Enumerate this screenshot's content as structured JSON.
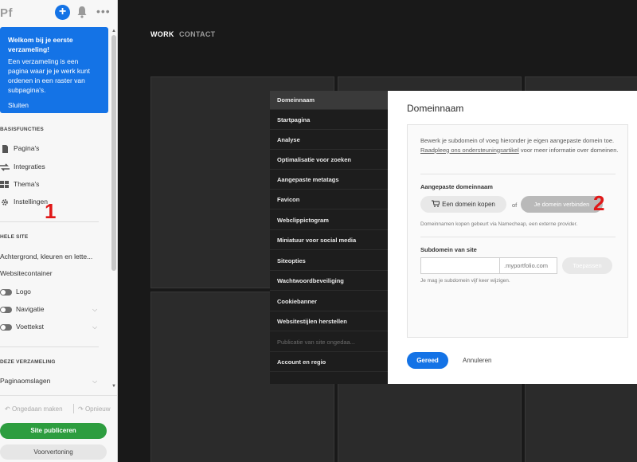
{
  "sidebar": {
    "logo": "Pf",
    "plus_label": "+",
    "more_label": "•••",
    "welcome": {
      "title": "Welkom bij je eerste verzameling!",
      "body": "Een verzameling is een pagina waar je je werk kunt ordenen in een raster van subpagina's.",
      "close": "Sluiten"
    },
    "basis": {
      "heading": "BASISFUNCTIES",
      "items": [
        "Pagina's",
        "Integraties",
        "Thema's",
        "Instellingen"
      ]
    },
    "site": {
      "heading": "HELE SITE",
      "items": [
        "Achtergrond, kleuren en lette...",
        "Websitecontainer"
      ],
      "toggles": [
        "Logo",
        "Navigatie",
        "Voettekst"
      ]
    },
    "collection": {
      "heading": "DEZE VERZAMELING",
      "items": [
        "Paginaomslagen"
      ]
    },
    "undo": "Ongedaan maken",
    "redo": "Opnieuw",
    "publish": "Site publiceren",
    "preview": "Voorvertoning"
  },
  "markers": {
    "one": "1",
    "two": "2"
  },
  "site_nav": {
    "work": "WORK",
    "contact": "CONTACT"
  },
  "modal_nav": {
    "items": [
      "Domeinnaam",
      "Startpagina",
      "Analyse",
      "Optimalisatie voor zoeken",
      "Aangepaste metatags",
      "Favicon",
      "Webclippictogram",
      "Miniatuur voor social media",
      "Siteopties",
      "Wachtwoordbeveiliging",
      "Cookiebanner",
      "Websitestijlen herstellen",
      "Publicatie van site ongedaa...",
      "Account en regio"
    ],
    "active_index": 0,
    "disabled_index": 12
  },
  "modal": {
    "title": "Domeinnaam",
    "intro_before": "Bewerk je subdomein of voeg hieronder je eigen aangepaste domein toe. ",
    "intro_link": "Raadpleeg ons ondersteuningsartikel",
    "intro_after": " voor meer informatie over domeinen.",
    "custom_label": "Aangepaste domeinnaam",
    "buy_label": "Een domein kopen",
    "or": "of",
    "connect_label": "Je domein verbinden",
    "namecheap_note": "Domeinnamen kopen gebeurt via Namecheap, een externe provider.",
    "subdomain_label": "Subdomein van site",
    "subdomain_value": "",
    "suffix": ".myportfolio.com",
    "apply_label": "Toepassen",
    "change_note": "Je mag je subdomein vijf keer wijzigen.",
    "done_label": "Gereed",
    "cancel_label": "Annuleren"
  },
  "colors": {
    "accent": "#1473e6",
    "publish": "#2d9d3f",
    "marker": "#e01818"
  }
}
